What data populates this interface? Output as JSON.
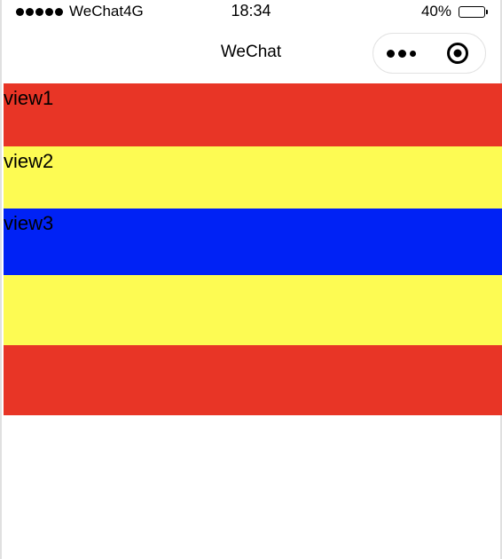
{
  "status_bar": {
    "carrier": "WeChat4G",
    "time": "18:34",
    "battery_percent": "40%",
    "battery_level": 0.4
  },
  "nav": {
    "title": "WeChat",
    "more_icon": "more-icon",
    "close_icon": "target-close-icon"
  },
  "views": [
    {
      "label": "view1",
      "color": "#e83526"
    },
    {
      "label": "view2",
      "color": "#fdfb53"
    },
    {
      "label": "view3",
      "color": "#0022f5"
    },
    {
      "label": "",
      "color": "#fdfb53"
    },
    {
      "label": "",
      "color": "#e83526"
    }
  ]
}
